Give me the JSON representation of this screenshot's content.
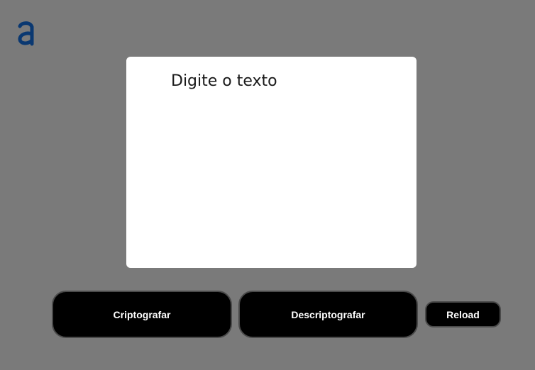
{
  "logo": {
    "icon": "alura-logo-icon",
    "color": "#0a3871"
  },
  "editor": {
    "placeholder": "Digite o texto",
    "value": ""
  },
  "actions": {
    "encrypt_label": "Criptografar",
    "decrypt_label": "Descriptografar",
    "reload_label": "Reload"
  },
  "colors": {
    "background": "#7a7a7a",
    "button_bg": "#000000",
    "button_text": "#ffffff",
    "panel_bg": "#ffffff"
  }
}
